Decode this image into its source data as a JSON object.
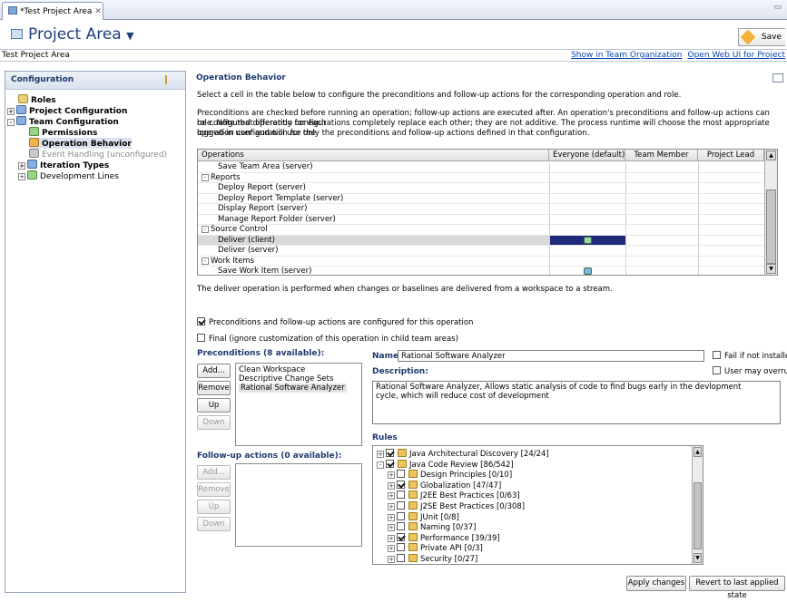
{
  "tab": {
    "title": "*Test Project Area"
  },
  "header": {
    "title": "Project Area",
    "save_label": "Save"
  },
  "namebar": {
    "name": "Test Project Area",
    "link1": "Show in Team Organization",
    "link2": "Open Web UI for Project"
  },
  "left": {
    "heading": "Configuration",
    "tree": [
      {
        "label": "Roles",
        "bold": true,
        "indent": 1,
        "expander": "",
        "icon": "roles-icon"
      },
      {
        "label": "Project Configuration",
        "bold": true,
        "indent": 0,
        "expander": "+",
        "icon": "project-config-icon"
      },
      {
        "label": "Team Configuration",
        "bold": true,
        "indent": 0,
        "expander": "-",
        "icon": "team-config-icon"
      },
      {
        "label": "Permissions",
        "bold": true,
        "indent": 2,
        "expander": "",
        "icon": "permissions-icon"
      },
      {
        "label": "Operation Behavior",
        "bold": true,
        "indent": 2,
        "expander": "",
        "icon": "operation-behavior-icon",
        "selected": true
      },
      {
        "label": "Event Handling (unconfigured)",
        "bold": false,
        "indent": 2,
        "expander": "",
        "icon": "event-handling-icon",
        "gray": true
      },
      {
        "label": "Iteration Types",
        "bold": true,
        "indent": 1,
        "expander": "+",
        "icon": "iteration-types-icon"
      },
      {
        "label": "Development Lines",
        "bold": false,
        "indent": 1,
        "expander": "+",
        "icon": "development-lines-icon"
      }
    ]
  },
  "right": {
    "heading": "Operation Behavior",
    "intro": "Select a cell in the table below to configure the preconditions and follow-up actions for the corresponding operation and role.",
    "para1": "Preconditions are checked before running an operation; follow-up actions are executed after. An operation's preconditions and follow-up actions can be configured differently for each",
    "para2": "role. Note that operation configurations completely replace each other; they are not additive. The process runtime will choose the most appropriate operation configuration for the",
    "para3": "logged-in user and will use only the preconditions and follow-up actions defined in that configuration.",
    "table": {
      "columns": [
        "Operations",
        "Everyone (default)",
        "Team Member",
        "Project Lead"
      ],
      "rows": [
        {
          "label": "Save Team Area (server)",
          "indent": 2
        },
        {
          "label": "Reports",
          "indent": 0,
          "expander": "-"
        },
        {
          "label": "Deploy Report (server)",
          "indent": 2
        },
        {
          "label": "Deploy Report Template (server)",
          "indent": 2
        },
        {
          "label": "Display Report (server)",
          "indent": 2
        },
        {
          "label": "Manage Report Folder (server)",
          "indent": 2
        },
        {
          "label": "Source Control",
          "indent": 0,
          "expander": "-"
        },
        {
          "label": "Deliver (client)",
          "indent": 2,
          "selected": true
        },
        {
          "label": "Deliver (server)",
          "indent": 2
        },
        {
          "label": "Work Items",
          "indent": 0,
          "expander": "-"
        },
        {
          "label": "Save Work Item (server)",
          "indent": 2,
          "configured": true
        }
      ]
    },
    "op_desc": "The deliver operation is performed when changes or baselines are delivered from a workspace to a stream.",
    "chk_configured": "Preconditions and follow-up actions are configured for this operation",
    "chk_final": "Final (ignore customization of this operation in child team areas)",
    "preconditions_label": "Preconditions (8 available):",
    "preconditions": [
      "Clean Workspace",
      "Descriptive Change Sets",
      "Rational Software Analyzer"
    ],
    "btn_add": "Add...",
    "btn_remove": "Remove",
    "btn_up": "Up",
    "btn_down": "Down",
    "followup_label": "Follow-up actions (0 available):",
    "name_label": "Name:",
    "name_value": "Rational Software Analyzer",
    "fail_label": "Fail if not installed",
    "override_label": "User may overrule",
    "desc_label": "Description:",
    "desc_value": "Rational Software Analyzer, Allows static analysis of code to find bugs early in the devlopment cycle, which will reduce cost of development",
    "rules_label": "Rules",
    "rules": [
      {
        "label": "Java Architectural Discovery [24/24]",
        "level": 0,
        "checked": true
      },
      {
        "label": "Java Code Review [86/542]",
        "level": 0,
        "checked": true,
        "expanded": true
      },
      {
        "label": "Design Principles [0/10]",
        "level": 1,
        "checked": false
      },
      {
        "label": "Globalization [47/47]",
        "level": 1,
        "checked": true
      },
      {
        "label": "J2EE Best Practices [0/63]",
        "level": 1,
        "checked": false
      },
      {
        "label": "J2SE Best Practices [0/308]",
        "level": 1,
        "checked": false
      },
      {
        "label": "JUnit [0/8]",
        "level": 1,
        "checked": false
      },
      {
        "label": "Naming [0/37]",
        "level": 1,
        "checked": false
      },
      {
        "label": "Performance [39/39]",
        "level": 1,
        "checked": true
      },
      {
        "label": "Private API [0/3]",
        "level": 1,
        "checked": false
      },
      {
        "label": "Security [0/27]",
        "level": 1,
        "checked": false
      }
    ],
    "apply_label": "Apply changes",
    "revert_label": "Revert to last applied state"
  }
}
